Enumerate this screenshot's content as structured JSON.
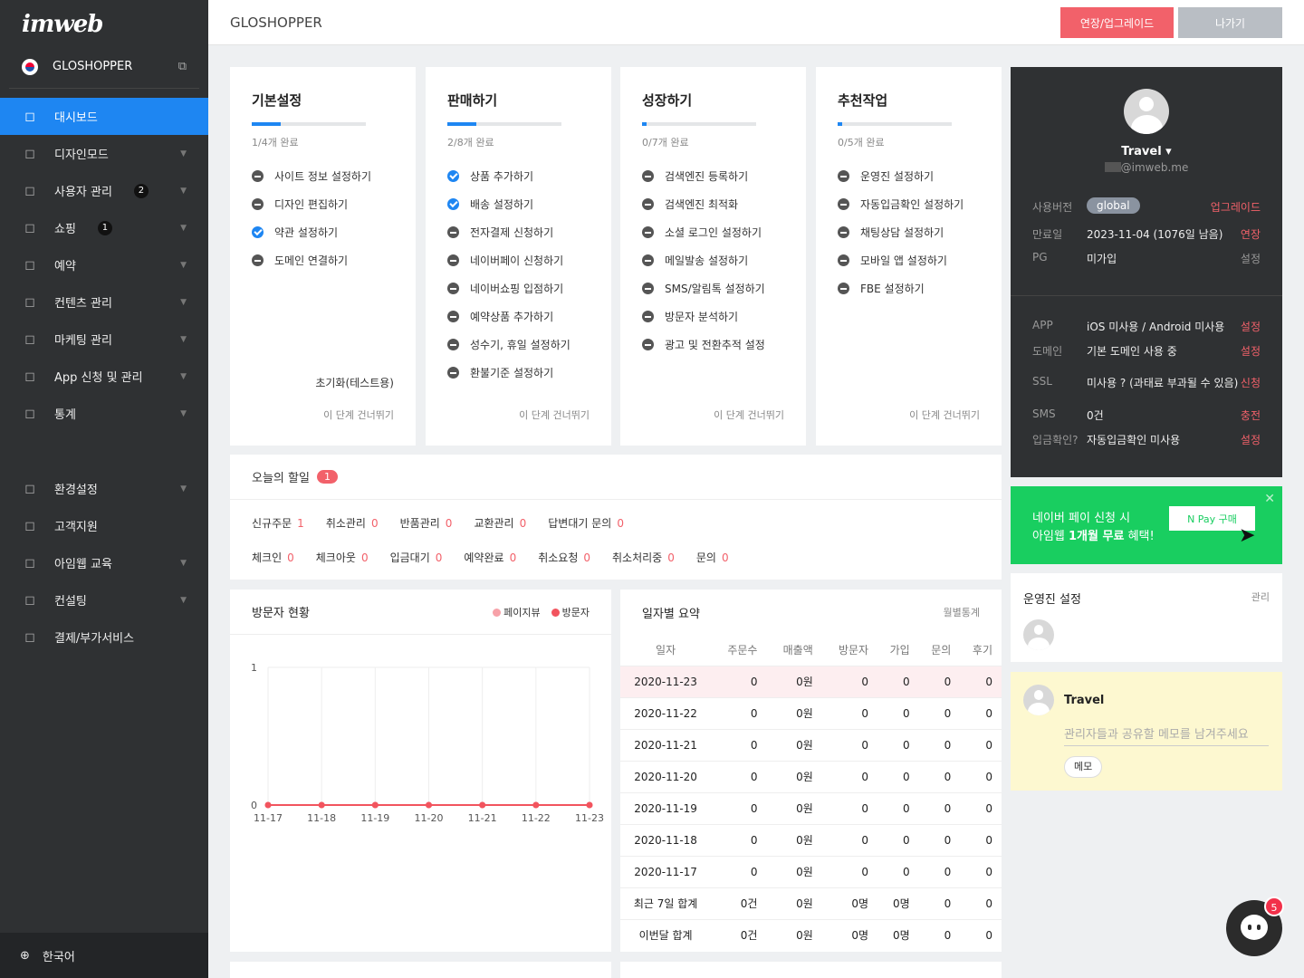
{
  "brand": {
    "logo": "imweb",
    "site": "GLOSHOPPER"
  },
  "nav": [
    {
      "label": "대시보드",
      "icon": "grid-icon",
      "badge": "",
      "caret": false
    },
    {
      "label": "디자인모드",
      "icon": "pin-icon",
      "badge": "",
      "caret": true
    },
    {
      "label": "사용자 관리",
      "icon": "user-icon",
      "badge": "2",
      "caret": true
    },
    {
      "label": "쇼핑",
      "icon": "bag-icon",
      "badge": "1",
      "caret": true
    },
    {
      "label": "예약",
      "icon": "calendar-icon",
      "badge": "",
      "caret": true
    },
    {
      "label": "컨텐츠 관리",
      "icon": "edit-icon",
      "badge": "",
      "caret": true
    },
    {
      "label": "마케팅 관리",
      "icon": "megaphone-icon",
      "badge": "",
      "caret": true
    },
    {
      "label": "App 신청 및 관리",
      "icon": "phone-icon",
      "badge": "",
      "caret": true
    },
    {
      "label": "통계",
      "icon": "chart-icon",
      "badge": "",
      "caret": true
    }
  ],
  "nav2": [
    {
      "label": "환경설정",
      "icon": "gear-icon",
      "caret": true
    },
    {
      "label": "고객지원",
      "icon": "chat-icon",
      "caret": false
    },
    {
      "label": "아임웹 교육",
      "icon": "graduation-icon",
      "caret": true
    },
    {
      "label": "컨설팅",
      "icon": "glasses-icon",
      "caret": true
    },
    {
      "label": "결제/부가서비스",
      "icon": "rocket-icon",
      "caret": false
    }
  ],
  "language": "한국어",
  "topbar": {
    "title": "GLOSHOPPER",
    "upgrade": "연장/업그레이드",
    "exit": "나가기"
  },
  "steps": [
    {
      "title": "기본설정",
      "done": "1/4개 완료",
      "progress": 0.25,
      "items": [
        {
          "t": "사이트 정보 설정하기",
          "ok": false
        },
        {
          "t": "디자인 편집하기",
          "ok": false
        },
        {
          "t": "약관 설정하기",
          "ok": true
        },
        {
          "t": "도메인 연결하기",
          "ok": false
        }
      ],
      "reset": "초기화(테스트용)",
      "skip": "이 단계 건너뛰기"
    },
    {
      "title": "판매하기",
      "done": "2/8개 완료",
      "progress": 0.25,
      "items": [
        {
          "t": "상품 추가하기",
          "ok": true
        },
        {
          "t": "배송 설정하기",
          "ok": true
        },
        {
          "t": "전자결제 신청하기",
          "ok": false
        },
        {
          "t": "네이버페이 신청하기",
          "ok": false
        },
        {
          "t": "네이버쇼핑 입점하기",
          "ok": false
        },
        {
          "t": "예약상품 추가하기",
          "ok": false
        },
        {
          "t": "성수기, 휴일 설정하기",
          "ok": false
        },
        {
          "t": "환불기준 설정하기",
          "ok": false
        }
      ],
      "reset": "",
      "skip": "이 단계 건너뛰기"
    },
    {
      "title": "성장하기",
      "done": "0/7개 완료",
      "progress": 0.04,
      "items": [
        {
          "t": "검색엔진 등록하기",
          "ok": false
        },
        {
          "t": "검색엔진 최적화",
          "ok": false
        },
        {
          "t": "소셜 로그인 설정하기",
          "ok": false
        },
        {
          "t": "메일발송 설정하기",
          "ok": false
        },
        {
          "t": "SMS/알림톡 설정하기",
          "ok": false
        },
        {
          "t": "방문자 분석하기",
          "ok": false
        },
        {
          "t": "광고 및 전환추적 설정",
          "ok": false
        }
      ],
      "reset": "",
      "skip": "이 단계 건너뛰기"
    },
    {
      "title": "추천작업",
      "done": "0/5개 완료",
      "progress": 0.04,
      "items": [
        {
          "t": "운영진 설정하기",
          "ok": false
        },
        {
          "t": "자동입금확인 설정하기",
          "ok": false
        },
        {
          "t": "채팅상담 설정하기",
          "ok": false
        },
        {
          "t": "모바일 앱 설정하기",
          "ok": false
        },
        {
          "t": "FBE 설정하기",
          "ok": false
        }
      ],
      "reset": "",
      "skip": "이 단계 건너뛰기"
    }
  ],
  "todo": {
    "title": "오늘의 할일",
    "count": "1",
    "row1": [
      {
        "k": "신규주문",
        "v": "1"
      },
      {
        "k": "취소관리",
        "v": "0"
      },
      {
        "k": "반품관리",
        "v": "0"
      },
      {
        "k": "교환관리",
        "v": "0"
      },
      {
        "k": "답변대기 문의",
        "v": "0"
      }
    ],
    "row2": [
      {
        "k": "체크인",
        "v": "0"
      },
      {
        "k": "체크아웃",
        "v": "0"
      },
      {
        "k": "입금대기",
        "v": "0"
      },
      {
        "k": "예약완료",
        "v": "0"
      },
      {
        "k": "취소요청",
        "v": "0"
      },
      {
        "k": "취소처리중",
        "v": "0"
      },
      {
        "k": "문의",
        "v": "0"
      }
    ]
  },
  "visitors": {
    "title": "방문자 현황",
    "legend_pv": "페이지뷰",
    "legend_v": "방문자"
  },
  "chart_data": {
    "type": "line",
    "x": [
      "11-17",
      "11-18",
      "11-19",
      "11-20",
      "11-21",
      "11-22",
      "11-23"
    ],
    "series": [
      {
        "name": "페이지뷰",
        "values": [
          0,
          0,
          0,
          0,
          0,
          0,
          0
        ],
        "color": "#f7a1a8"
      },
      {
        "name": "방문자",
        "values": [
          0,
          0,
          0,
          0,
          0,
          0,
          0
        ],
        "color": "#f2545e"
      }
    ],
    "ylim": [
      0,
      1
    ],
    "yticks": [
      "0",
      "1"
    ],
    "grid": true
  },
  "daily": {
    "title": "일자별 요약",
    "link": "월별통계",
    "headers": [
      "일자",
      "주문수",
      "매출액",
      "방문자",
      "가입",
      "문의",
      "후기"
    ],
    "rows": [
      [
        "2020-11-23",
        "0",
        "0원",
        "0",
        "0",
        "0",
        "0"
      ],
      [
        "2020-11-22",
        "0",
        "0원",
        "0",
        "0",
        "0",
        "0"
      ],
      [
        "2020-11-21",
        "0",
        "0원",
        "0",
        "0",
        "0",
        "0"
      ],
      [
        "2020-11-20",
        "0",
        "0원",
        "0",
        "0",
        "0",
        "0"
      ],
      [
        "2020-11-19",
        "0",
        "0원",
        "0",
        "0",
        "0",
        "0"
      ],
      [
        "2020-11-18",
        "0",
        "0원",
        "0",
        "0",
        "0",
        "0"
      ],
      [
        "2020-11-17",
        "0",
        "0원",
        "0",
        "0",
        "0",
        "0"
      ],
      [
        "최근 7일 합계",
        "0건",
        "0원",
        "0명",
        "0명",
        "0",
        "0"
      ],
      [
        "이번달 합계",
        "0건",
        "0원",
        "0명",
        "0명",
        "0",
        "0"
      ]
    ]
  },
  "profile": {
    "name": "Travel ▾",
    "email": "@imweb.me",
    "version_k": "사용버전",
    "version": "global",
    "version_a": "업그레이드",
    "expire_k": "만료일",
    "expire": "2023-11-04 (1076일 남음)",
    "expire_a": "연장",
    "pg_k": "PG",
    "pg": "미가입",
    "pg_a": "설정",
    "app_k": "APP",
    "app": "iOS 미사용 / Android 미사용",
    "app_a": "설정",
    "domain_k": "도메인",
    "domain": "기본 도메인 사용 중",
    "domain_a": "설정",
    "ssl_k": "SSL",
    "ssl": "미사용 ? (과태료 부과될 수 있음)",
    "ssl_a": "신청",
    "sms_k": "SMS",
    "sms": "0건",
    "sms_a": "충전",
    "dep_k": "입금확인?",
    "dep": "자동입금확인 미사용",
    "dep_a": "설정"
  },
  "npay": {
    "line1": "네이버 페이 신청 시",
    "line2a": "아임웹 ",
    "line2b": "1개월 무료",
    "line2c": " 혜택!",
    "btn": "N Pay 구매"
  },
  "staff": {
    "title": "운영진 설정",
    "link": "관리"
  },
  "memo": {
    "name": "Travel",
    "placeholder": "관리자들과 공유할 메모를 남겨주세요",
    "btn": "메모"
  },
  "chat": {
    "count": "5"
  }
}
